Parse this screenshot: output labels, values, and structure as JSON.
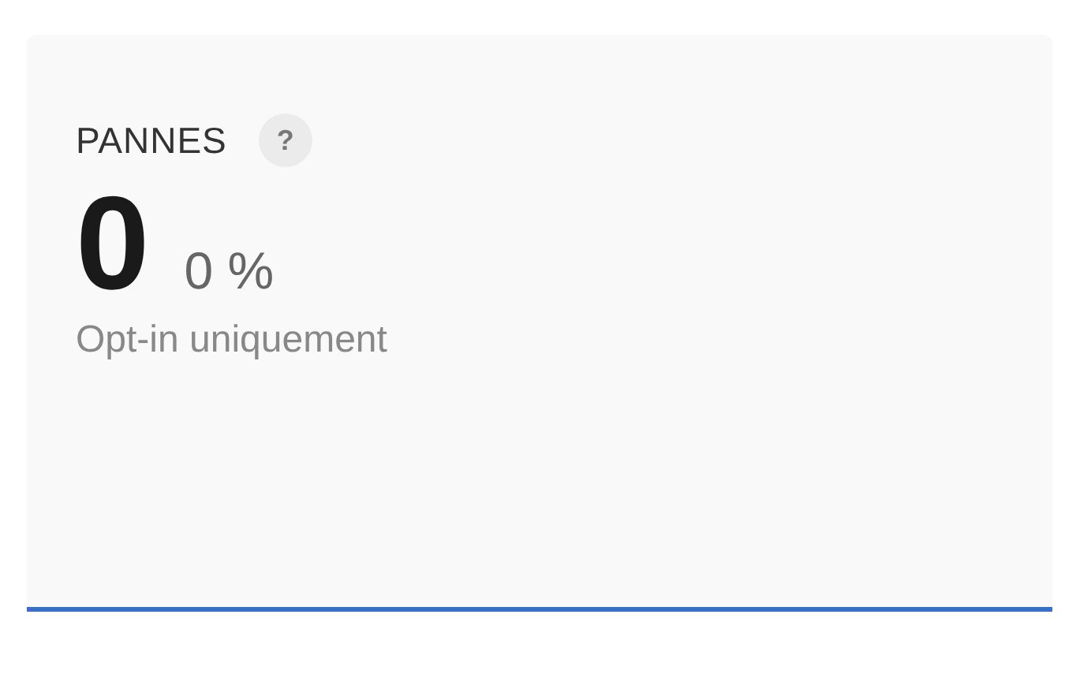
{
  "card": {
    "title": "PANNES",
    "help": "?",
    "value": "0",
    "percent": "0 %",
    "note": "Opt-in uniquement"
  }
}
